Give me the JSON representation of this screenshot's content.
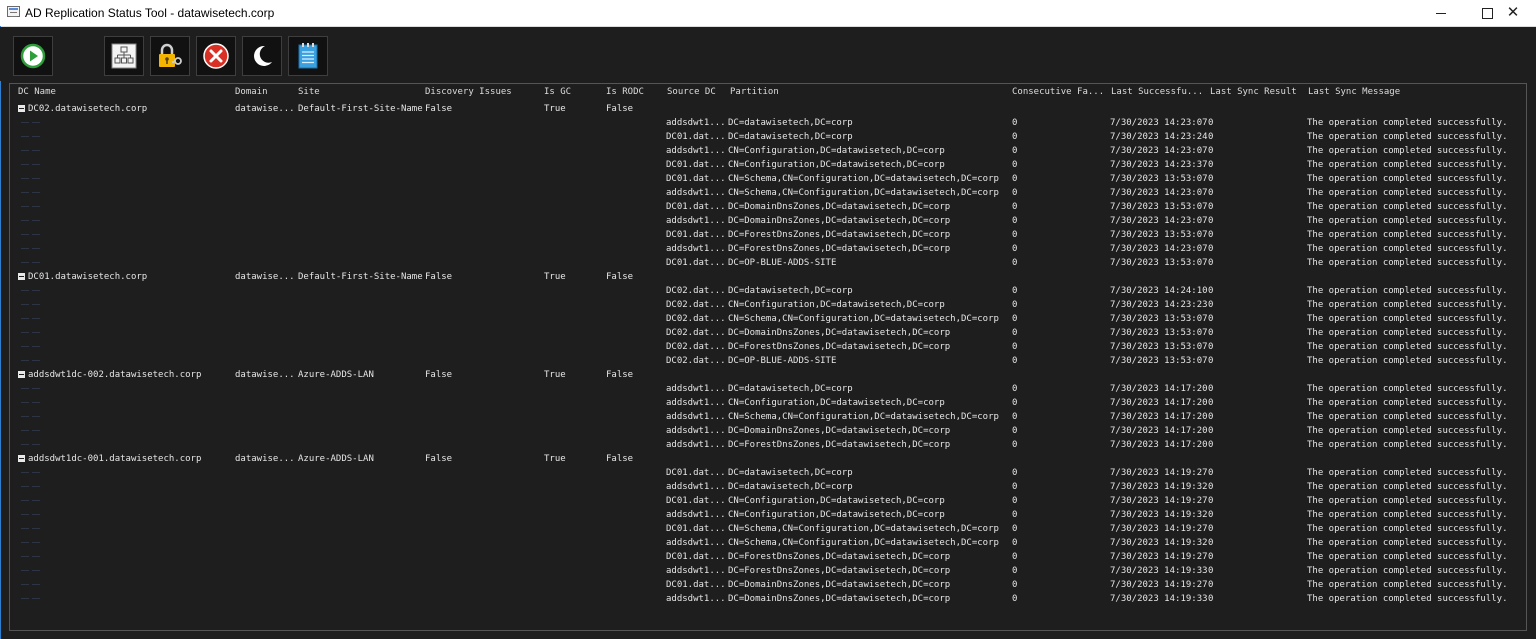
{
  "window": {
    "title": "AD Replication Status Tool - datawisetech.corp",
    "minimize_glyph": "—",
    "close_glyph": "✕"
  },
  "toolbar": {
    "buttons": [
      {
        "name": "run",
        "icon": "play-icon",
        "color": "#2e9e3a"
      },
      {
        "name": "topology",
        "icon": "topology-icon",
        "color": "#ffffff"
      },
      {
        "name": "credentials",
        "icon": "lock-key-icon",
        "color": "#f5b400"
      },
      {
        "name": "stop",
        "icon": "stop-icon",
        "color": "#d93025"
      },
      {
        "name": "theme",
        "icon": "moon-icon",
        "color": "#ffffff"
      },
      {
        "name": "notes",
        "icon": "notepad-icon",
        "color": "#3aa0e0"
      }
    ]
  },
  "columns": {
    "dc_name": "DC Name",
    "domain": "Domain",
    "site": "Site",
    "discovery_issues": "Discovery Issues",
    "is_gc": "Is GC",
    "is_rodc": "Is RODC",
    "source_dc": "Source DC",
    "partition": "Partition",
    "consecutive_failures": "Consecutive Fa...",
    "last_success": "Last Successfu...",
    "last_sync_result": "Last Sync Result",
    "last_sync_message": "Last Sync Message"
  },
  "groups": [
    {
      "dc_name": "DC02.datawisetech.corp",
      "domain": "datawise...",
      "site": "Default-First-Site-Name",
      "discovery_issues": "False",
      "is_gc": "True",
      "is_rodc": "False",
      "rows": [
        {
          "source": "addsdwt1...",
          "partition": "DC=datawisetech,DC=corp",
          "failures": "0",
          "last_success": "7/30/2023 14:23:07",
          "result": "0",
          "message": "The operation completed successfully."
        },
        {
          "source": "DC01.dat...",
          "partition": "DC=datawisetech,DC=corp",
          "failures": "0",
          "last_success": "7/30/2023 14:23:24",
          "result": "0",
          "message": "The operation completed successfully."
        },
        {
          "source": "addsdwt1...",
          "partition": "CN=Configuration,DC=datawisetech,DC=corp",
          "failures": "0",
          "last_success": "7/30/2023 14:23:07",
          "result": "0",
          "message": "The operation completed successfully."
        },
        {
          "source": "DC01.dat...",
          "partition": "CN=Configuration,DC=datawisetech,DC=corp",
          "failures": "0",
          "last_success": "7/30/2023 14:23:37",
          "result": "0",
          "message": "The operation completed successfully."
        },
        {
          "source": "DC01.dat...",
          "partition": "CN=Schema,CN=Configuration,DC=datawisetech,DC=corp",
          "failures": "0",
          "last_success": "7/30/2023 13:53:07",
          "result": "0",
          "message": "The operation completed successfully."
        },
        {
          "source": "addsdwt1...",
          "partition": "CN=Schema,CN=Configuration,DC=datawisetech,DC=corp",
          "failures": "0",
          "last_success": "7/30/2023 14:23:07",
          "result": "0",
          "message": "The operation completed successfully."
        },
        {
          "source": "DC01.dat...",
          "partition": "DC=DomainDnsZones,DC=datawisetech,DC=corp",
          "failures": "0",
          "last_success": "7/30/2023 13:53:07",
          "result": "0",
          "message": "The operation completed successfully."
        },
        {
          "source": "addsdwt1...",
          "partition": "DC=DomainDnsZones,DC=datawisetech,DC=corp",
          "failures": "0",
          "last_success": "7/30/2023 14:23:07",
          "result": "0",
          "message": "The operation completed successfully."
        },
        {
          "source": "DC01.dat...",
          "partition": "DC=ForestDnsZones,DC=datawisetech,DC=corp",
          "failures": "0",
          "last_success": "7/30/2023 13:53:07",
          "result": "0",
          "message": "The operation completed successfully."
        },
        {
          "source": "addsdwt1...",
          "partition": "DC=ForestDnsZones,DC=datawisetech,DC=corp",
          "failures": "0",
          "last_success": "7/30/2023 14:23:07",
          "result": "0",
          "message": "The operation completed successfully."
        },
        {
          "source": "DC01.dat...",
          "partition": "DC=OP-BLUE-ADDS-SITE",
          "failures": "0",
          "last_success": "7/30/2023 13:53:07",
          "result": "0",
          "message": "The operation completed successfully."
        }
      ]
    },
    {
      "dc_name": "DC01.datawisetech.corp",
      "domain": "datawise...",
      "site": "Default-First-Site-Name",
      "discovery_issues": "False",
      "is_gc": "True",
      "is_rodc": "False",
      "rows": [
        {
          "source": "DC02.dat...",
          "partition": "DC=datawisetech,DC=corp",
          "failures": "0",
          "last_success": "7/30/2023 14:24:10",
          "result": "0",
          "message": "The operation completed successfully."
        },
        {
          "source": "DC02.dat...",
          "partition": "CN=Configuration,DC=datawisetech,DC=corp",
          "failures": "0",
          "last_success": "7/30/2023 14:23:23",
          "result": "0",
          "message": "The operation completed successfully."
        },
        {
          "source": "DC02.dat...",
          "partition": "CN=Schema,CN=Configuration,DC=datawisetech,DC=corp",
          "failures": "0",
          "last_success": "7/30/2023 13:53:07",
          "result": "0",
          "message": "The operation completed successfully."
        },
        {
          "source": "DC02.dat...",
          "partition": "DC=DomainDnsZones,DC=datawisetech,DC=corp",
          "failures": "0",
          "last_success": "7/30/2023 13:53:07",
          "result": "0",
          "message": "The operation completed successfully."
        },
        {
          "source": "DC02.dat...",
          "partition": "DC=ForestDnsZones,DC=datawisetech,DC=corp",
          "failures": "0",
          "last_success": "7/30/2023 13:53:07",
          "result": "0",
          "message": "The operation completed successfully."
        },
        {
          "source": "DC02.dat...",
          "partition": "DC=OP-BLUE-ADDS-SITE",
          "failures": "0",
          "last_success": "7/30/2023 13:53:07",
          "result": "0",
          "message": "The operation completed successfully."
        }
      ]
    },
    {
      "dc_name": "addsdwt1dc-002.datawisetech.corp",
      "domain": "datawise...",
      "site": "Azure-ADDS-LAN",
      "discovery_issues": "False",
      "is_gc": "True",
      "is_rodc": "False",
      "rows": [
        {
          "source": "addsdwt1...",
          "partition": "DC=datawisetech,DC=corp",
          "failures": "0",
          "last_success": "7/30/2023 14:17:20",
          "result": "0",
          "message": "The operation completed successfully."
        },
        {
          "source": "addsdwt1...",
          "partition": "CN=Configuration,DC=datawisetech,DC=corp",
          "failures": "0",
          "last_success": "7/30/2023 14:17:20",
          "result": "0",
          "message": "The operation completed successfully."
        },
        {
          "source": "addsdwt1...",
          "partition": "CN=Schema,CN=Configuration,DC=datawisetech,DC=corp",
          "failures": "0",
          "last_success": "7/30/2023 14:17:20",
          "result": "0",
          "message": "The operation completed successfully."
        },
        {
          "source": "addsdwt1...",
          "partition": "DC=DomainDnsZones,DC=datawisetech,DC=corp",
          "failures": "0",
          "last_success": "7/30/2023 14:17:20",
          "result": "0",
          "message": "The operation completed successfully."
        },
        {
          "source": "addsdwt1...",
          "partition": "DC=ForestDnsZones,DC=datawisetech,DC=corp",
          "failures": "0",
          "last_success": "7/30/2023 14:17:20",
          "result": "0",
          "message": "The operation completed successfully."
        }
      ]
    },
    {
      "dc_name": "addsdwt1dc-001.datawisetech.corp",
      "domain": "datawise...",
      "site": "Azure-ADDS-LAN",
      "discovery_issues": "False",
      "is_gc": "True",
      "is_rodc": "False",
      "rows": [
        {
          "source": "DC01.dat...",
          "partition": "DC=datawisetech,DC=corp",
          "failures": "0",
          "last_success": "7/30/2023 14:19:27",
          "result": "0",
          "message": "The operation completed successfully."
        },
        {
          "source": "addsdwt1...",
          "partition": "DC=datawisetech,DC=corp",
          "failures": "0",
          "last_success": "7/30/2023 14:19:32",
          "result": "0",
          "message": "The operation completed successfully."
        },
        {
          "source": "DC01.dat...",
          "partition": "CN=Configuration,DC=datawisetech,DC=corp",
          "failures": "0",
          "last_success": "7/30/2023 14:19:27",
          "result": "0",
          "message": "The operation completed successfully."
        },
        {
          "source": "addsdwt1...",
          "partition": "CN=Configuration,DC=datawisetech,DC=corp",
          "failures": "0",
          "last_success": "7/30/2023 14:19:32",
          "result": "0",
          "message": "The operation completed successfully."
        },
        {
          "source": "DC01.dat...",
          "partition": "CN=Schema,CN=Configuration,DC=datawisetech,DC=corp",
          "failures": "0",
          "last_success": "7/30/2023 14:19:27",
          "result": "0",
          "message": "The operation completed successfully."
        },
        {
          "source": "addsdwt1...",
          "partition": "CN=Schema,CN=Configuration,DC=datawisetech,DC=corp",
          "failures": "0",
          "last_success": "7/30/2023 14:19:32",
          "result": "0",
          "message": "The operation completed successfully."
        },
        {
          "source": "DC01.dat...",
          "partition": "DC=ForestDnsZones,DC=datawisetech,DC=corp",
          "failures": "0",
          "last_success": "7/30/2023 14:19:27",
          "result": "0",
          "message": "The operation completed successfully."
        },
        {
          "source": "addsdwt1...",
          "partition": "DC=ForestDnsZones,DC=datawisetech,DC=corp",
          "failures": "0",
          "last_success": "7/30/2023 14:19:33",
          "result": "0",
          "message": "The operation completed successfully."
        },
        {
          "source": "DC01.dat...",
          "partition": "DC=DomainDnsZones,DC=datawisetech,DC=corp",
          "failures": "0",
          "last_success": "7/30/2023 14:19:27",
          "result": "0",
          "message": "The operation completed successfully."
        },
        {
          "source": "addsdwt1...",
          "partition": "DC=DomainDnsZones,DC=datawisetech,DC=corp",
          "failures": "0",
          "last_success": "7/30/2023 14:19:33",
          "result": "0",
          "message": "The operation completed successfully."
        }
      ]
    }
  ]
}
